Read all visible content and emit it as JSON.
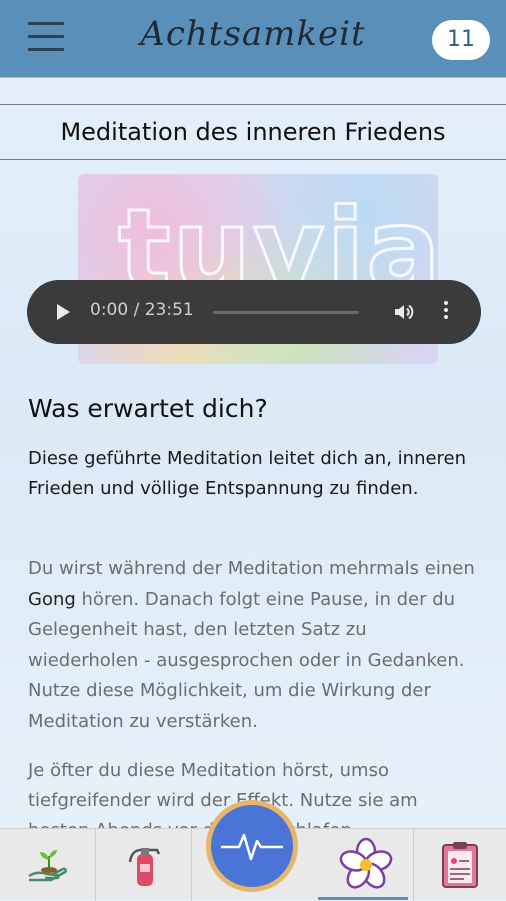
{
  "header": {
    "app_title": "Achtsamkeit",
    "badge_count": "11"
  },
  "page": {
    "title": "Meditation des inneren Friedens",
    "hero_brand": "tuvia"
  },
  "player": {
    "time_display": "0:00 / 23:51"
  },
  "article": {
    "heading": "Was erwartet dich?",
    "lead": "Diese geführte Meditation leitet dich an, inneren Frieden und völlige Entspannung zu finden.",
    "para1_before": "Du wirst während der Meditation mehrmals einen ",
    "para1_bold": "Gong",
    "para1_after": " hören. Danach folgt eine Pause, in der du Gelegenheit hast, den letzten Satz zu wiederholen - ausgesprochen oder in Gedanken. Nutze diese Möglichkeit, um die Wirkung der Meditation zu verstärken.",
    "para2": "Je öfter du diese Meditation hörst, umso tiefgreifender wird der Effekt. Nutze sie am besten Abends vor dem Einschlafen."
  },
  "colors": {
    "header_bg": "#5a8fba",
    "center_button": "#4a74d6",
    "center_ring": "#e6b76b"
  },
  "nav_icons": [
    "plant-hand-icon",
    "fire-extinguisher-icon",
    "heartbeat-icon",
    "flower-icon",
    "clipboard-icon"
  ]
}
